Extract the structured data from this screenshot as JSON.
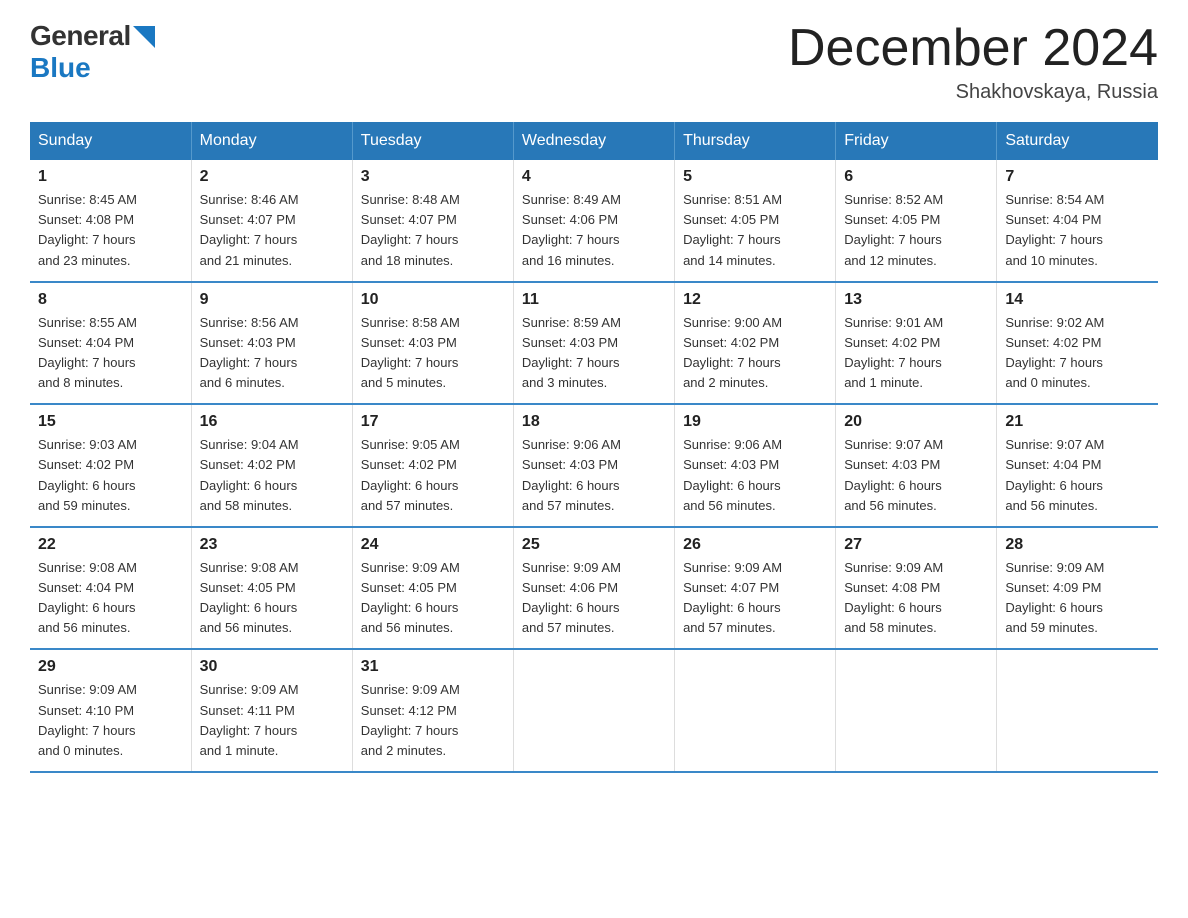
{
  "header": {
    "logo_general": "General",
    "logo_blue": "Blue",
    "month_title": "December 2024",
    "location": "Shakhovskaya, Russia"
  },
  "days_of_week": [
    "Sunday",
    "Monday",
    "Tuesday",
    "Wednesday",
    "Thursday",
    "Friday",
    "Saturday"
  ],
  "weeks": [
    [
      {
        "day": "1",
        "sunrise": "8:45 AM",
        "sunset": "4:08 PM",
        "daylight": "7 hours and 23 minutes."
      },
      {
        "day": "2",
        "sunrise": "8:46 AM",
        "sunset": "4:07 PM",
        "daylight": "7 hours and 21 minutes."
      },
      {
        "day": "3",
        "sunrise": "8:48 AM",
        "sunset": "4:07 PM",
        "daylight": "7 hours and 18 minutes."
      },
      {
        "day": "4",
        "sunrise": "8:49 AM",
        "sunset": "4:06 PM",
        "daylight": "7 hours and 16 minutes."
      },
      {
        "day": "5",
        "sunrise": "8:51 AM",
        "sunset": "4:05 PM",
        "daylight": "7 hours and 14 minutes."
      },
      {
        "day": "6",
        "sunrise": "8:52 AM",
        "sunset": "4:05 PM",
        "daylight": "7 hours and 12 minutes."
      },
      {
        "day": "7",
        "sunrise": "8:54 AM",
        "sunset": "4:04 PM",
        "daylight": "7 hours and 10 minutes."
      }
    ],
    [
      {
        "day": "8",
        "sunrise": "8:55 AM",
        "sunset": "4:04 PM",
        "daylight": "7 hours and 8 minutes."
      },
      {
        "day": "9",
        "sunrise": "8:56 AM",
        "sunset": "4:03 PM",
        "daylight": "7 hours and 6 minutes."
      },
      {
        "day": "10",
        "sunrise": "8:58 AM",
        "sunset": "4:03 PM",
        "daylight": "7 hours and 5 minutes."
      },
      {
        "day": "11",
        "sunrise": "8:59 AM",
        "sunset": "4:03 PM",
        "daylight": "7 hours and 3 minutes."
      },
      {
        "day": "12",
        "sunrise": "9:00 AM",
        "sunset": "4:02 PM",
        "daylight": "7 hours and 2 minutes."
      },
      {
        "day": "13",
        "sunrise": "9:01 AM",
        "sunset": "4:02 PM",
        "daylight": "7 hours and 1 minute."
      },
      {
        "day": "14",
        "sunrise": "9:02 AM",
        "sunset": "4:02 PM",
        "daylight": "7 hours and 0 minutes."
      }
    ],
    [
      {
        "day": "15",
        "sunrise": "9:03 AM",
        "sunset": "4:02 PM",
        "daylight": "6 hours and 59 minutes."
      },
      {
        "day": "16",
        "sunrise": "9:04 AM",
        "sunset": "4:02 PM",
        "daylight": "6 hours and 58 minutes."
      },
      {
        "day": "17",
        "sunrise": "9:05 AM",
        "sunset": "4:02 PM",
        "daylight": "6 hours and 57 minutes."
      },
      {
        "day": "18",
        "sunrise": "9:06 AM",
        "sunset": "4:03 PM",
        "daylight": "6 hours and 57 minutes."
      },
      {
        "day": "19",
        "sunrise": "9:06 AM",
        "sunset": "4:03 PM",
        "daylight": "6 hours and 56 minutes."
      },
      {
        "day": "20",
        "sunrise": "9:07 AM",
        "sunset": "4:03 PM",
        "daylight": "6 hours and 56 minutes."
      },
      {
        "day": "21",
        "sunrise": "9:07 AM",
        "sunset": "4:04 PM",
        "daylight": "6 hours and 56 minutes."
      }
    ],
    [
      {
        "day": "22",
        "sunrise": "9:08 AM",
        "sunset": "4:04 PM",
        "daylight": "6 hours and 56 minutes."
      },
      {
        "day": "23",
        "sunrise": "9:08 AM",
        "sunset": "4:05 PM",
        "daylight": "6 hours and 56 minutes."
      },
      {
        "day": "24",
        "sunrise": "9:09 AM",
        "sunset": "4:05 PM",
        "daylight": "6 hours and 56 minutes."
      },
      {
        "day": "25",
        "sunrise": "9:09 AM",
        "sunset": "4:06 PM",
        "daylight": "6 hours and 57 minutes."
      },
      {
        "day": "26",
        "sunrise": "9:09 AM",
        "sunset": "4:07 PM",
        "daylight": "6 hours and 57 minutes."
      },
      {
        "day": "27",
        "sunrise": "9:09 AM",
        "sunset": "4:08 PM",
        "daylight": "6 hours and 58 minutes."
      },
      {
        "day": "28",
        "sunrise": "9:09 AM",
        "sunset": "4:09 PM",
        "daylight": "6 hours and 59 minutes."
      }
    ],
    [
      {
        "day": "29",
        "sunrise": "9:09 AM",
        "sunset": "4:10 PM",
        "daylight": "7 hours and 0 minutes."
      },
      {
        "day": "30",
        "sunrise": "9:09 AM",
        "sunset": "4:11 PM",
        "daylight": "7 hours and 1 minute."
      },
      {
        "day": "31",
        "sunrise": "9:09 AM",
        "sunset": "4:12 PM",
        "daylight": "7 hours and 2 minutes."
      },
      {
        "day": "",
        "sunrise": "",
        "sunset": "",
        "daylight": ""
      },
      {
        "day": "",
        "sunrise": "",
        "sunset": "",
        "daylight": ""
      },
      {
        "day": "",
        "sunrise": "",
        "sunset": "",
        "daylight": ""
      },
      {
        "day": "",
        "sunrise": "",
        "sunset": "",
        "daylight": ""
      }
    ]
  ],
  "labels": {
    "sunrise": "Sunrise:",
    "sunset": "Sunset:",
    "daylight": "Daylight:"
  }
}
